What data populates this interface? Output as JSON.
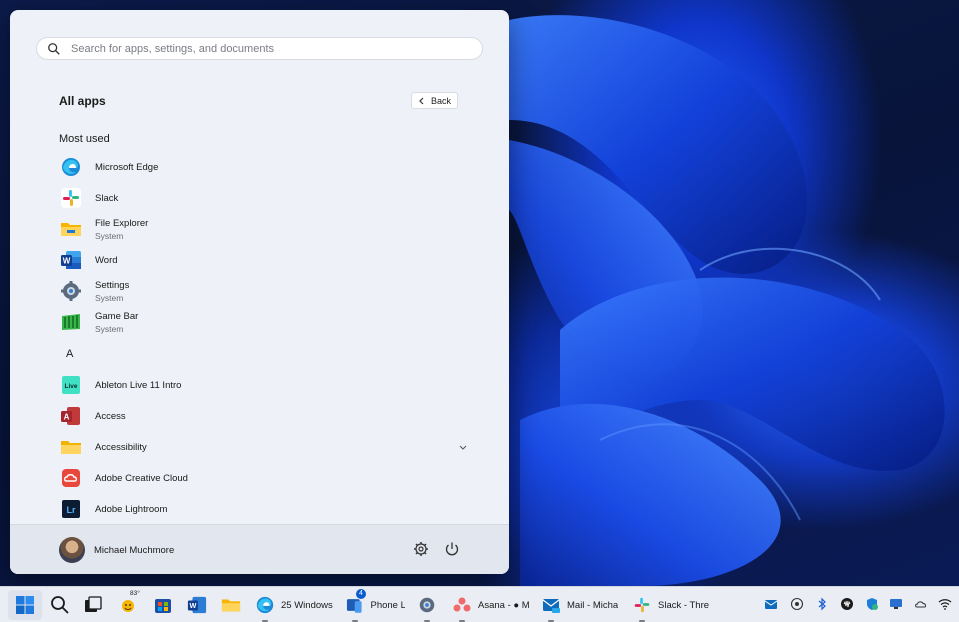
{
  "start_menu": {
    "search_placeholder": "Search for apps, settings, and documents",
    "title": "All apps",
    "back_label": "Back",
    "sections": {
      "most_used": "Most used",
      "letter_a": "A"
    },
    "most_used": [
      {
        "name": "Microsoft Edge",
        "sub": ""
      },
      {
        "name": "Slack",
        "sub": ""
      },
      {
        "name": "File Explorer",
        "sub": "System"
      },
      {
        "name": "Word",
        "sub": ""
      },
      {
        "name": "Settings",
        "sub": "System"
      },
      {
        "name": "Game Bar",
        "sub": "System"
      }
    ],
    "a_apps": [
      {
        "name": "Ableton Live 11 Intro",
        "icon_text": "Live"
      },
      {
        "name": "Access",
        "icon_text": "A"
      },
      {
        "name": "Accessibility",
        "icon_text": ""
      },
      {
        "name": "Adobe Creative Cloud",
        "icon_text": ""
      },
      {
        "name": "Adobe Lightroom",
        "icon_text": "Lr"
      }
    ],
    "user_name": "Michael Muchmore"
  },
  "taskbar": {
    "weather_temp": "83°",
    "phone_badge": "4",
    "items": {
      "edge": "25 Windows",
      "phone": "Phone L",
      "asana": "Asana - ● M",
      "mail": "Mail - Micha",
      "slack": "Slack - Thre"
    }
  },
  "colors": {
    "accent": "#0a5bd0",
    "menu_bg": "#eef1f7"
  }
}
